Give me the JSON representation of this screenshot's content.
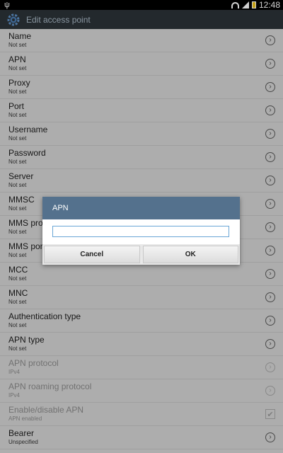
{
  "status_bar": {
    "usb_icon": "usb-icon",
    "time": "12:48"
  },
  "action_bar": {
    "title": "Edit access point",
    "icon": "settings-gear-icon"
  },
  "items": [
    {
      "label": "Name",
      "value": "Not set",
      "control": "chevron"
    },
    {
      "label": "APN",
      "value": "Not set",
      "control": "chevron"
    },
    {
      "label": "Proxy",
      "value": "Not set",
      "control": "chevron"
    },
    {
      "label": "Port",
      "value": "Not set",
      "control": "chevron"
    },
    {
      "label": "Username",
      "value": "Not set",
      "control": "chevron"
    },
    {
      "label": "Password",
      "value": "Not set",
      "control": "chevron"
    },
    {
      "label": "Server",
      "value": "Not set",
      "control": "chevron"
    },
    {
      "label": "MMSC",
      "value": "Not set",
      "control": "chevron"
    },
    {
      "label": "MMS proxy",
      "value": "Not set",
      "control": "chevron"
    },
    {
      "label": "MMS port",
      "value": "Not set",
      "control": "chevron"
    },
    {
      "label": "MCC",
      "value": "Not set",
      "control": "chevron"
    },
    {
      "label": "MNC",
      "value": "Not set",
      "control": "chevron"
    },
    {
      "label": "Authentication type",
      "value": "Not set",
      "control": "chevron"
    },
    {
      "label": "APN type",
      "value": "Not set",
      "control": "chevron"
    },
    {
      "label": "APN protocol",
      "value": "IPv4",
      "control": "chevron",
      "disabled": true
    },
    {
      "label": "APN roaming protocol",
      "value": "IPv4",
      "control": "chevron",
      "disabled": true
    },
    {
      "label": "Enable/disable APN",
      "value": "APN enabled",
      "control": "checkbox",
      "disabled": true
    },
    {
      "label": "Bearer",
      "value": "Unspecified",
      "control": "chevron"
    }
  ],
  "dialog": {
    "title": "APN",
    "input_value": "",
    "cancel_label": "Cancel",
    "ok_label": "OK"
  },
  "colors": {
    "dialog_title_bg": "#54718d",
    "action_bar_bg": "#2b3238",
    "input_border": "#6aa6d6"
  }
}
